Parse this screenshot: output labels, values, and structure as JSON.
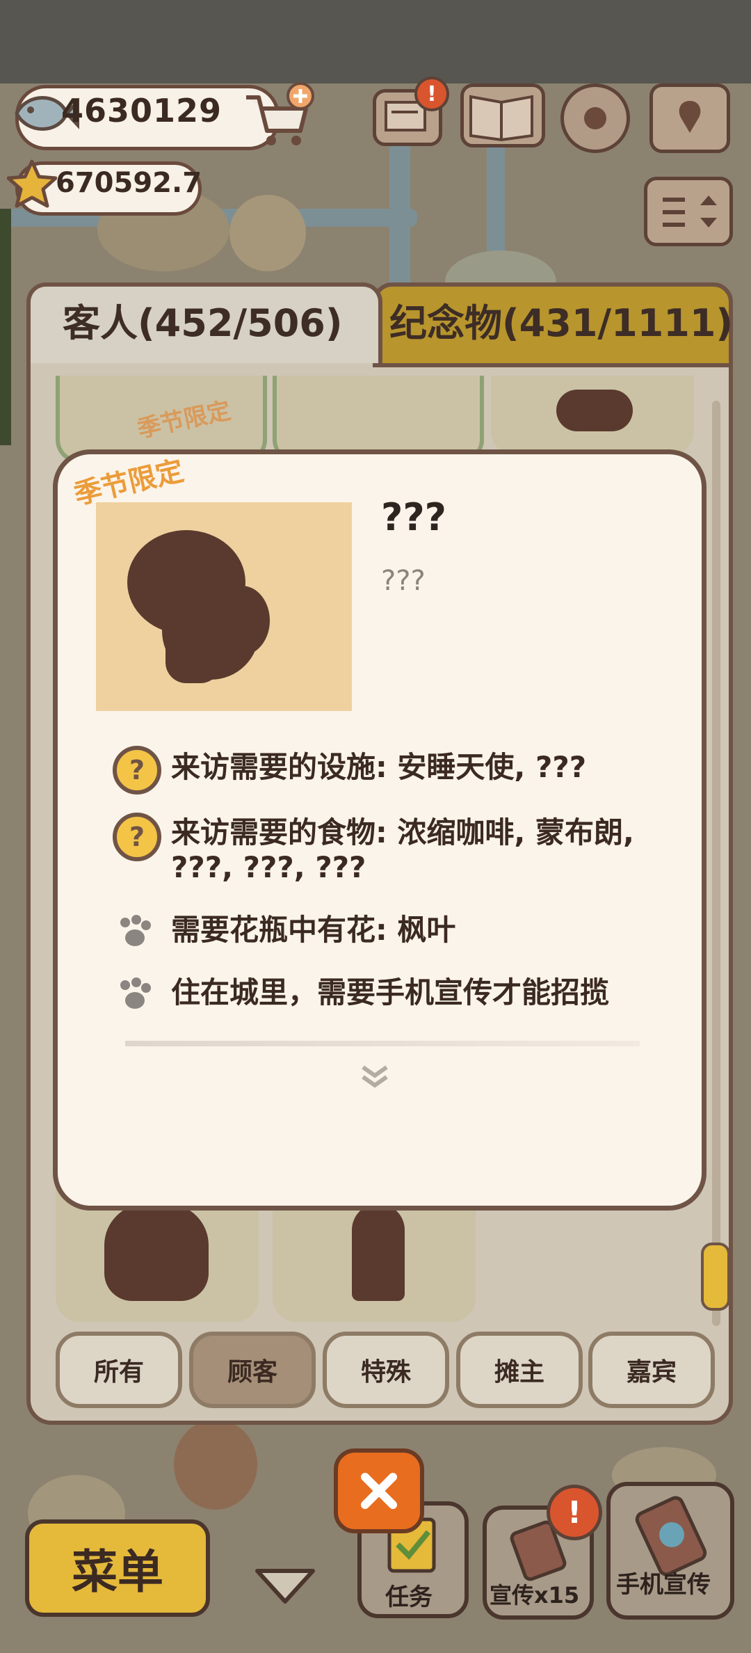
{
  "currency": {
    "fish": "4630129",
    "stars": "670592.7"
  },
  "tabs": [
    {
      "label": "客人(452/506)",
      "active": true
    },
    {
      "label": "纪念物(431/1111)",
      "active": false
    }
  ],
  "card_tag": "季节限定",
  "detail": {
    "tag": "季节限定",
    "name": "???",
    "description": "???",
    "requirements": [
      {
        "icon": "question-icon",
        "text": "来访需要的设施: 安睡天使, ???"
      },
      {
        "icon": "question-icon",
        "text": "来访需要的食物: 浓缩咖啡, 蒙布朗, ???, ???, ???"
      },
      {
        "icon": "paw-icon",
        "text": "需要花瓶中有花: 枫叶"
      },
      {
        "icon": "paw-icon",
        "text": "住在城里，需要手机宣传才能招揽"
      }
    ]
  },
  "filters": [
    {
      "label": "所有",
      "active": false
    },
    {
      "label": "顾客",
      "active": true
    },
    {
      "label": "特殊",
      "active": false
    },
    {
      "label": "摊主",
      "active": false
    },
    {
      "label": "嘉宾",
      "active": false
    }
  ],
  "bottom": {
    "menu": "菜单",
    "tasks": "任务",
    "promo": "宣传x15",
    "phone_promo": "手机宣传"
  },
  "colors": {
    "accent": "#b8952d",
    "panel": "#cfc6b6",
    "popup": "#fbf4ea",
    "border": "#6f5446",
    "close": "#e86d1f"
  }
}
